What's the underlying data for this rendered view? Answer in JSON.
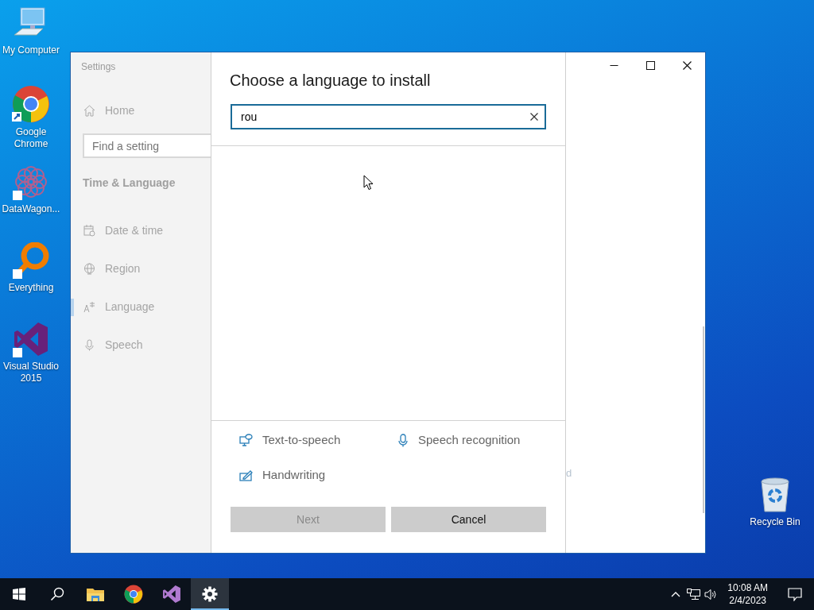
{
  "desktop_icons": [
    {
      "label": "My Computer",
      "kind": "computer"
    },
    {
      "label": "Google Chrome",
      "kind": "chrome"
    },
    {
      "label": "DataWagon...",
      "kind": "datawagon"
    },
    {
      "label": "Everything",
      "kind": "everything"
    },
    {
      "label": "Visual Studio 2015",
      "kind": "vs"
    },
    {
      "label": "Recycle Bin",
      "kind": "recycle"
    }
  ],
  "settings": {
    "app_title": "Settings",
    "home": "Home",
    "search_placeholder": "Find a setting",
    "section": "Time & Language",
    "items": [
      {
        "label": "Date & time",
        "kind": "calendar",
        "selected": false
      },
      {
        "label": "Region",
        "kind": "globe",
        "selected": false
      },
      {
        "label": "Language",
        "kind": "language",
        "selected": true
      },
      {
        "label": "Speech",
        "kind": "mic",
        "selected": false
      }
    ]
  },
  "dialog": {
    "title": "Choose a language to install",
    "search": {
      "value": "rou"
    },
    "features": [
      {
        "label": "Text-to-speech",
        "kind": "tts"
      },
      {
        "label": "Speech recognition",
        "kind": "mic"
      },
      {
        "label": "Handwriting",
        "kind": "pen"
      }
    ],
    "buttons": [
      {
        "label": "Next",
        "disabled": true
      },
      {
        "label": "Cancel",
        "disabled": false
      }
    ]
  },
  "background_fragment": "d",
  "taskbar": {
    "apps": [
      {
        "kind": "explorer",
        "selected": false
      },
      {
        "kind": "chrome",
        "selected": false
      },
      {
        "kind": "vs",
        "selected": false
      },
      {
        "kind": "settings",
        "selected": true
      }
    ],
    "time": "10:08 AM",
    "date": "2/4/2023"
  }
}
